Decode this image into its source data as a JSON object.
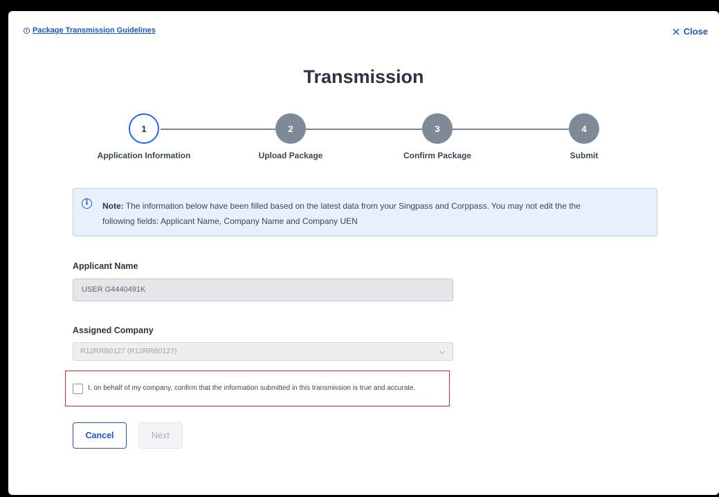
{
  "header": {
    "guidelines_link": "Package Transmission Guidelines",
    "close_label": "Close",
    "title": "Transmission"
  },
  "stepper": {
    "steps": [
      {
        "number": "1",
        "label": "Application Information",
        "state": "active"
      },
      {
        "number": "2",
        "label": "Upload Package",
        "state": "inactive"
      },
      {
        "number": "3",
        "label": "Confirm Package",
        "state": "inactive"
      },
      {
        "number": "4",
        "label": "Submit",
        "state": "inactive"
      }
    ]
  },
  "note": {
    "prefix": "Note:",
    "line1": "The information below have been filled based on the latest data from your Singpass and Corppass. You may not edit the the",
    "line2": "following fields: Applicant Name, Company Name and Company UEN"
  },
  "form": {
    "applicant_label": "Applicant Name",
    "applicant_value": "USER G4440491K",
    "company_label": "Assigned Company",
    "company_value": "R12RRB0127 (R12RRB0127)",
    "confirm_text": "I, on behalf of my company, confirm that the information submitted in this transmission is true and accurate.",
    "confirm_checked": false
  },
  "actions": {
    "cancel_label": "Cancel",
    "next_label": "Next"
  },
  "colors": {
    "accent": "#1a56c9",
    "step_inactive": "#7f8a97",
    "highlight_border": "#d62828"
  }
}
